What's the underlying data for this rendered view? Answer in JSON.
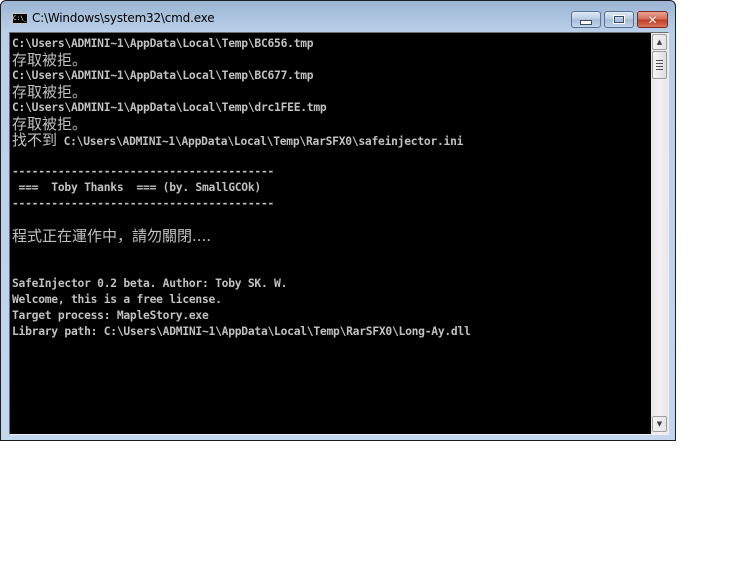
{
  "window": {
    "title": "C:\\Windows\\system32\\cmd.exe",
    "icon": "cmd-icon",
    "icon_text": "C:\\_",
    "controls": {
      "minimize": "minimize-icon",
      "maximize": "maximize-icon",
      "close": "close-icon",
      "close_glyph": "✕"
    },
    "colors": {
      "console_background": "#000000",
      "console_text": "#c0c0c0",
      "close_button": "#c7442e",
      "frame": "#b8cfe8"
    }
  },
  "console": {
    "lines": [
      {
        "type": "ascii",
        "text": "C:\\Users\\ADMINI~1\\AppData\\Local\\Temp\\BC656.tmp"
      },
      {
        "type": "cjk",
        "text": "存取被拒。"
      },
      {
        "type": "ascii",
        "text": "C:\\Users\\ADMINI~1\\AppData\\Local\\Temp\\BC677.tmp"
      },
      {
        "type": "cjk",
        "text": "存取被拒。"
      },
      {
        "type": "ascii",
        "text": "C:\\Users\\ADMINI~1\\AppData\\Local\\Temp\\drc1FEE.tmp"
      },
      {
        "type": "cjk",
        "text": "存取被拒。"
      },
      {
        "type": "mixed",
        "prefix": "找不到",
        "text": " C:\\Users\\ADMINI~1\\AppData\\Local\\Temp\\RarSFX0\\safeinjector.ini"
      },
      {
        "type": "ascii",
        "text": ""
      },
      {
        "type": "ascii",
        "text": "----------------------------------------"
      },
      {
        "type": "ascii",
        "text": " ===  Toby Thanks  === (by. SmallGCOk)"
      },
      {
        "type": "ascii",
        "text": "----------------------------------------"
      },
      {
        "type": "ascii",
        "text": ""
      },
      {
        "type": "cjk",
        "text": "程式正在運作中，請勿關閉...."
      },
      {
        "type": "ascii",
        "text": ""
      },
      {
        "type": "ascii",
        "text": ""
      },
      {
        "type": "ascii",
        "text": "SafeInjector 0.2 beta. Author: Toby SK. W."
      },
      {
        "type": "ascii",
        "text": "Welcome, this is a free license."
      },
      {
        "type": "ascii",
        "text": "Target process: MapleStory.exe"
      },
      {
        "type": "ascii",
        "text": "Library path: C:\\Users\\ADMINI~1\\AppData\\Local\\Temp\\RarSFX0\\Long-Ay.dll"
      }
    ]
  },
  "scrollbar": {
    "up_arrow": "▲",
    "down_arrow": "▼",
    "position": 0.0
  }
}
